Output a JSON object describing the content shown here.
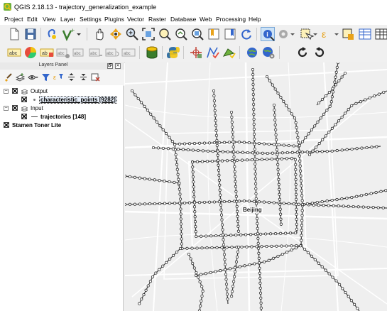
{
  "window": {
    "title": "QGIS 2.18.13 - trajectory_generalization_example"
  },
  "menubar": {
    "items": [
      "Project",
      "Edit",
      "View",
      "Layer",
      "Settings",
      "Plugins",
      "Vector",
      "Raster",
      "Database",
      "Web",
      "Processing",
      "Help"
    ]
  },
  "layers_panel": {
    "title": "Layers Panel",
    "float_symbol": "🗗",
    "close_symbol": "✕",
    "tree": [
      {
        "label": "Output",
        "type": "group",
        "expanded": true,
        "children": [
          {
            "label": "characteristic_points [9282]",
            "type": "point-layer",
            "checked": true,
            "selected": true
          }
        ]
      },
      {
        "label": "Input",
        "type": "group",
        "expanded": true,
        "children": [
          {
            "label": "trajectories [148]",
            "type": "line-layer",
            "checked": true
          }
        ]
      },
      {
        "label": "Stamen Toner Lite",
        "type": "raster-layer",
        "checked": true
      }
    ],
    "expander_symbols": {
      "expanded": "−"
    }
  },
  "map": {
    "city_label": "Beijing",
    "colors": {
      "background": "#efefef",
      "roads": "#ffffff",
      "trajectory": "#222222",
      "point_fill": "#ffffff",
      "point_stroke": "#222222"
    }
  },
  "toolbar_icons": {
    "row1": [
      "new-project-icon",
      "save-project-icon",
      "add-layer-icon",
      "add-vector-icon",
      "pan-icon",
      "pan-to-selection-icon",
      "zoom-in-icon",
      "zoom-full-icon",
      "zoom-to-selection-icon",
      "zoom-to-layer-icon",
      "zoom-native-icon",
      "new-bookmark-icon",
      "show-bookmarks-icon",
      "refresh-icon",
      "identify-icon",
      "action-icon",
      "select-icon",
      "deselect-icon",
      "attribute-table-icon"
    ],
    "row2": [
      "label-icon",
      "pie-diagram-icon",
      "layer-label-icon",
      "pin-label-icon",
      "show-label-icon",
      "move-label-icon",
      "rotate-label-icon",
      "change-label-icon",
      "db-manager-icon",
      "python-console-icon",
      "georeferencer-icon",
      "geometry-checker-icon",
      "topology-checker-icon",
      "globe-icon",
      "globe-settings-icon",
      "rotate-cw-icon",
      "rotate-ccw-icon"
    ]
  }
}
